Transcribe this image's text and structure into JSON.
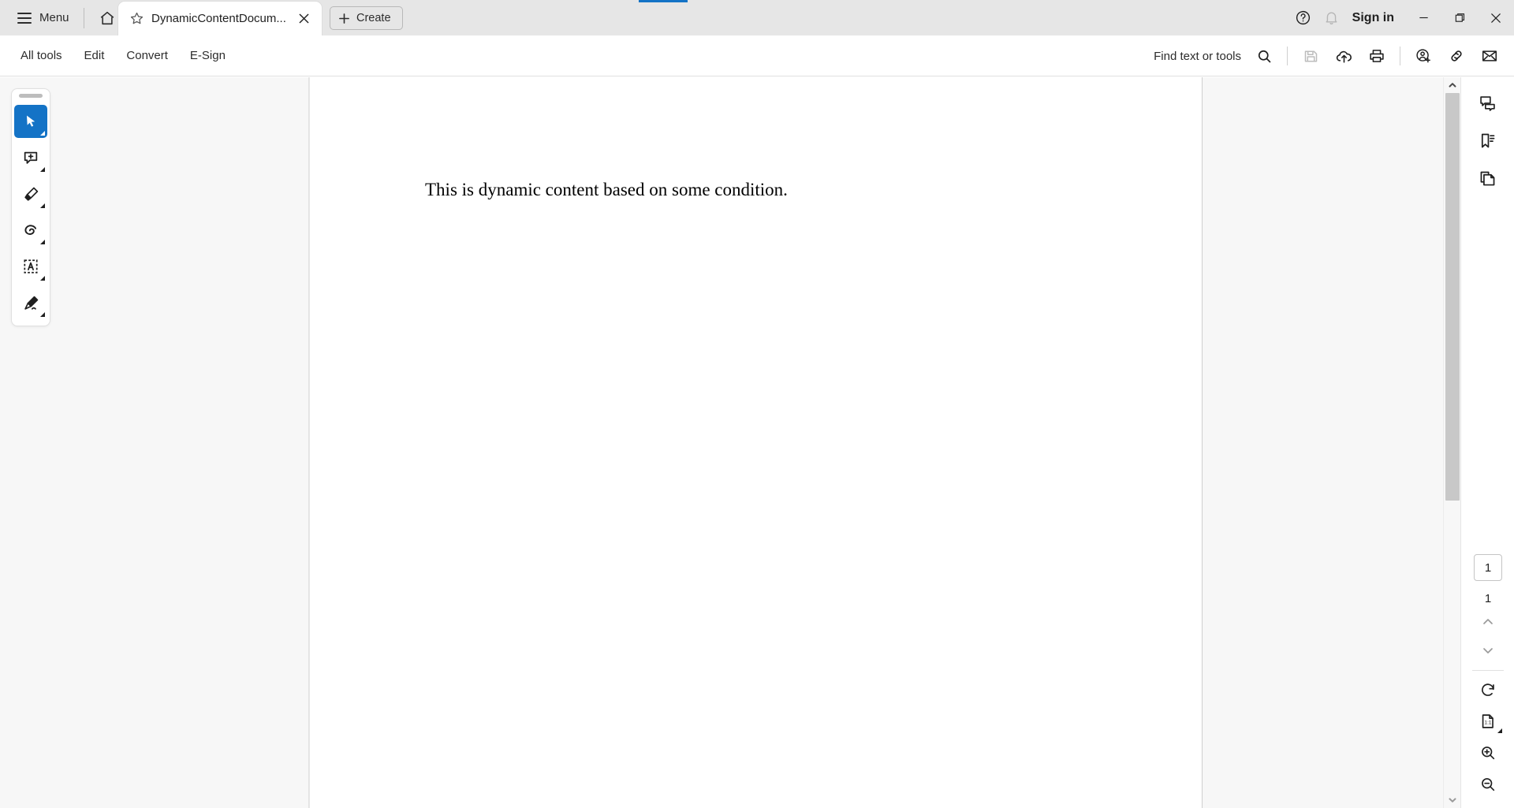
{
  "titlebar": {
    "menu_label": "Menu",
    "home_icon": "home-icon",
    "tab": {
      "star_icon": "star-icon",
      "title": "DynamicContentDocum...",
      "close_icon": "close-icon"
    },
    "create_label": "Create",
    "help_icon": "help-circle-icon",
    "bell_icon": "bell-icon",
    "signin_label": "Sign in",
    "minimize_icon": "minimize-icon",
    "maximize_icon": "maximize-icon",
    "close_icon": "window-close-icon",
    "accent_color": "#1473c6"
  },
  "toolbar": {
    "items": [
      {
        "label": "All tools"
      },
      {
        "label": "Edit"
      },
      {
        "label": "Convert"
      },
      {
        "label": "E-Sign"
      }
    ],
    "find_label": "Find text or tools",
    "icons": [
      {
        "name": "search-icon"
      },
      {
        "name": "save-icon",
        "disabled": true
      },
      {
        "name": "cloud-upload-icon"
      },
      {
        "name": "print-icon"
      },
      {
        "name": "add-person-icon"
      },
      {
        "name": "link-icon"
      },
      {
        "name": "email-icon"
      }
    ]
  },
  "tool_rail": {
    "tools": [
      {
        "name": "select-tool",
        "active": true
      },
      {
        "name": "add-comment-tool",
        "active": false
      },
      {
        "name": "highlight-tool",
        "active": false
      },
      {
        "name": "draw-freeform-tool",
        "active": false
      },
      {
        "name": "text-select-tool",
        "active": false
      },
      {
        "name": "fill-and-sign-tool",
        "active": false
      }
    ]
  },
  "document": {
    "body_text": "This is dynamic content based on some condition."
  },
  "right_rail": {
    "top_icons": [
      {
        "name": "comment-panel-icon"
      },
      {
        "name": "bookmark-panel-icon"
      },
      {
        "name": "page-thumbnails-icon"
      }
    ],
    "page_current": "1",
    "page_total": "1",
    "prev_page_icon": "chevron-up-icon",
    "next_page_icon": "chevron-down-icon",
    "rotate_icon": "rotate-icon",
    "fit_page_icon": "fit-one-to-one-icon",
    "zoom_in_icon": "zoom-in-icon",
    "zoom_out_icon": "zoom-out-icon"
  },
  "scrollbar": {
    "up_icon": "scroll-up-icon",
    "down_icon": "scroll-down-icon"
  }
}
